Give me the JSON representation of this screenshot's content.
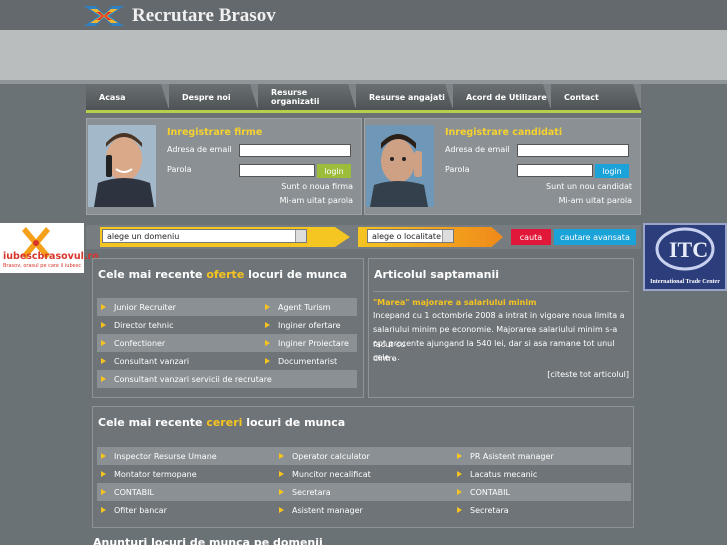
{
  "site": {
    "title": "Recrutare Brasov"
  },
  "nav": [
    "Acasa",
    "Despre noi",
    "Resurse organizatii",
    "Resurse angajati",
    "Acord de Utilizare",
    "Contact"
  ],
  "firme": {
    "title": "Inregistrare firme",
    "email_label": "Adresa de email",
    "pass_label": "Parola",
    "login": "login",
    "new": "Sunt o noua firma",
    "forgot": "Mi-am uitat parola"
  },
  "candidati": {
    "title": "Inregistrare candidati",
    "email_label": "Adresa de email",
    "pass_label": "Parola",
    "login": "login",
    "new": "Sunt un nou candidat",
    "forgot": "Mi-am uitat parola"
  },
  "search": {
    "domain": "alege un domeniu",
    "locality": "alege o localitate",
    "search": "cauta",
    "advanced": "cautare avansata"
  },
  "ads": {
    "left_title": "iubescbrasovul.ro",
    "left_sub": "Brasov, orasul pe care il iubesc",
    "right_text": "International Trade Center",
    "right_logo": "ITC"
  },
  "offers": {
    "title_pre": "Cele mai recente ",
    "title_hl": "oferte",
    "title_post": " locuri de munca",
    "jobs": [
      "Junior Recruiter",
      "Agent Turism",
      "Director tehnic",
      "Inginer ofertare",
      "Confectioner",
      "Inginer Proiectare",
      "Consultant vanzari",
      "Documentarist",
      "Consultant vanzari servicii de recrutare",
      ""
    ]
  },
  "article": {
    "title": "Articolul saptamanii",
    "headline": "\"Marea\" majorare a salariului minim",
    "lines": [
      "Incepand cu 1 octombrie 2008 a intrat in vigoare noua limita a",
      "salariului minim pe economie. Majorarea salariului minim s-a facut cu",
      "opt procente ajungand la 540 lei, dar si asa ramane tot unul dintre",
      "cele ..."
    ],
    "more": "[citeste tot articolul]"
  },
  "requests": {
    "title_pre": "Cele mai recente ",
    "title_hl": "cereri",
    "title_post": " locuri de munca",
    "jobs": [
      "Inspector Resurse Umane",
      "Operator calculator",
      "PR Asistent manager",
      "Montator termopane",
      "Muncitor necalificat",
      "Lacatus mecanic",
      "CONTABIL",
      "Secretara",
      "CONTABIL",
      "Ofiter bancar",
      "Asistent manager",
      "Secretara"
    ]
  },
  "bottom": {
    "title": "Anunturi locuri de munca pe domenii"
  },
  "colors": {
    "accent": "#f7c41f",
    "nav_line": "#b7d04b",
    "search_red": "#e2183a",
    "search_blue": "#1ba3d9"
  }
}
